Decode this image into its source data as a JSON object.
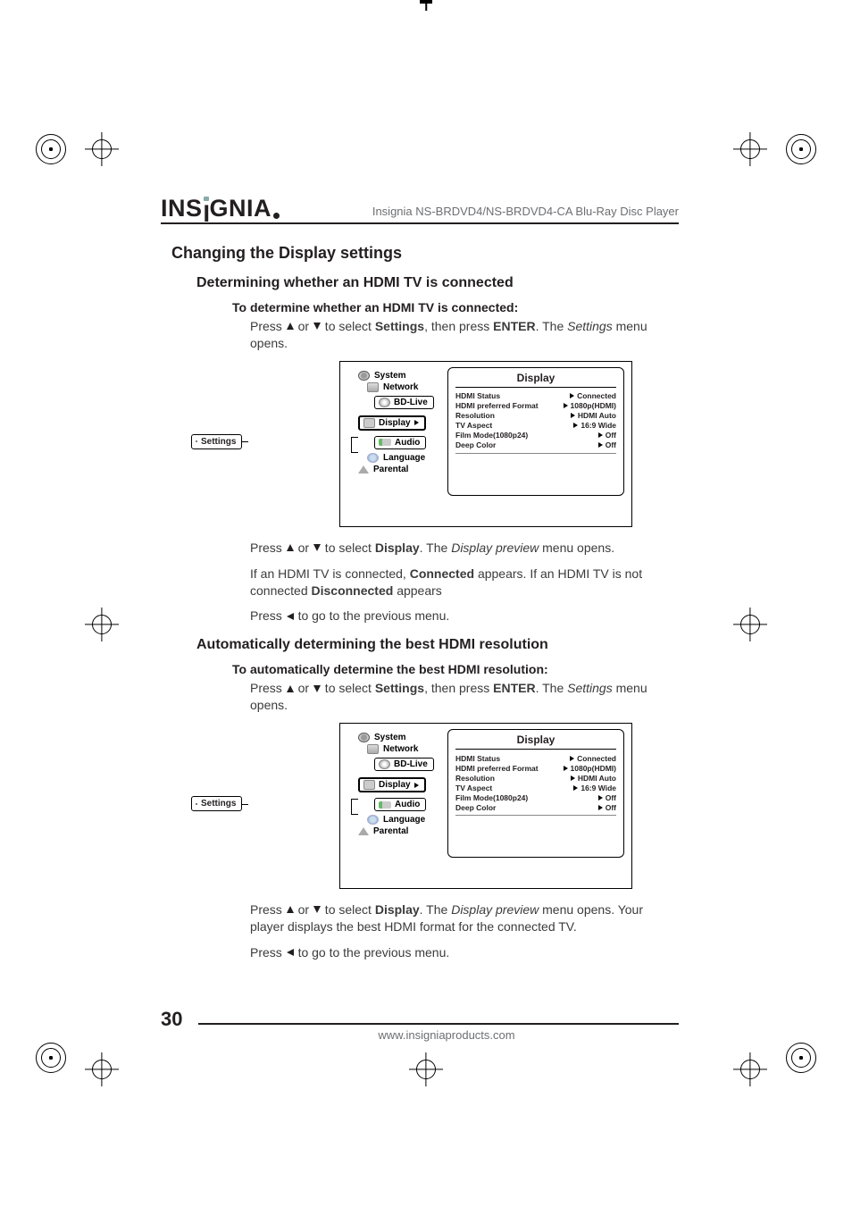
{
  "header": {
    "brand_left": "INS",
    "brand_right": "GNIA",
    "model": "Insignia NS-BRDVD4/NS-BRDVD4-CA Blu-Ray Disc Player"
  },
  "section": {
    "title": "Changing the Display settings",
    "sub1": {
      "title": "Determining whether an HDMI TV is connected",
      "step_heading": "To determine whether an HDMI TV is connected:",
      "p1_a": "Press ",
      "p1_b": " or ",
      "p1_c": " to select ",
      "p1_settings": "Settings",
      "p1_d": ", then press ",
      "p1_enter": "ENTER",
      "p1_e": ". The ",
      "p1_settings_ital": "Settings",
      "p1_f": " menu opens.",
      "p2_a": "Press ",
      "p2_b": " or ",
      "p2_c": " to select ",
      "p2_display": "Display",
      "p2_d": ". The ",
      "p2_preview_ital": "Display preview",
      "p2_e": " menu opens.",
      "p3_a": "If an HDMI TV is connected, ",
      "p3_connected": "Connected",
      "p3_b": " appears. If an HDMI TV is not connected ",
      "p3_disconnected": "Disconnected",
      "p3_c": " appears",
      "p4_a": "Press ",
      "p4_b": " to go to the previous menu."
    },
    "sub2": {
      "title": "Automatically determining the best HDMI resolution",
      "step_heading": "To automatically determine the best HDMI resolution:",
      "p1_a": "Press ",
      "p1_b": " or ",
      "p1_c": " to select ",
      "p1_settings": "Settings",
      "p1_d": ", then press ",
      "p1_enter": "ENTER",
      "p1_e": ". The ",
      "p1_settings_ital": "Settings",
      "p1_f": " menu opens.",
      "p2_a": "Press ",
      "p2_b": " or ",
      "p2_c": " to select ",
      "p2_display": "Display",
      "p2_d": ". The ",
      "p2_preview_ital": "Display preview",
      "p2_e": " menu opens. Your player displays the best HDMI format for the connected TV.",
      "p3_a": "Press ",
      "p3_b": " to go to the previous menu."
    }
  },
  "osd": {
    "settings": "Settings",
    "menu": {
      "system": "System",
      "network": "Network",
      "bdlive": "BD-Live",
      "display": "Display",
      "audio": "Audio",
      "language": "Language",
      "parental": "Parental"
    },
    "panel_title": "Display",
    "rows": [
      {
        "label": "HDMI Status",
        "value": "Connected"
      },
      {
        "label": "HDMI preferred Format",
        "value": "1080p(HDMI)"
      },
      {
        "label": "Resolution",
        "value": "HDMI Auto"
      },
      {
        "label": "TV Aspect",
        "value": "16:9 Wide"
      },
      {
        "label": "Film Mode(1080p24)",
        "value": "Off"
      },
      {
        "label": "Deep Color",
        "value": "Off"
      }
    ]
  },
  "footer": {
    "page": "30",
    "url": "www.insigniaproducts.com"
  }
}
